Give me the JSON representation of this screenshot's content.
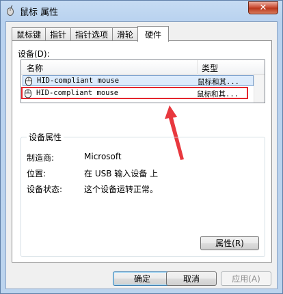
{
  "window": {
    "title": "鼠标 属性",
    "close_label": "✕"
  },
  "tabs": [
    {
      "label": "鼠标键",
      "active": false
    },
    {
      "label": "指针",
      "active": false
    },
    {
      "label": "指针选项",
      "active": false
    },
    {
      "label": "滑轮",
      "active": false
    },
    {
      "label": "硬件",
      "active": true
    }
  ],
  "devices": {
    "label": "设备(D):",
    "columns": {
      "name": "名称",
      "type": "类型"
    },
    "rows": [
      {
        "name": "HID-compliant mouse",
        "type": "鼠标和其..."
      },
      {
        "name": "HID-compliant mouse",
        "type": "鼠标和其..."
      }
    ]
  },
  "properties": {
    "group_title": "设备属性",
    "manufacturer_label": "制造商:",
    "manufacturer_value": "Microsoft",
    "location_label": "位置:",
    "location_value": "在 USB 输入设备 上",
    "status_label": "设备状态:",
    "status_value": "这个设备运转正常。",
    "properties_button": "属性(R)"
  },
  "buttons": {
    "ok": "确定",
    "cancel": "取消",
    "apply": "应用(A)"
  },
  "annotation": {
    "highlight_color": "#e3262e"
  }
}
